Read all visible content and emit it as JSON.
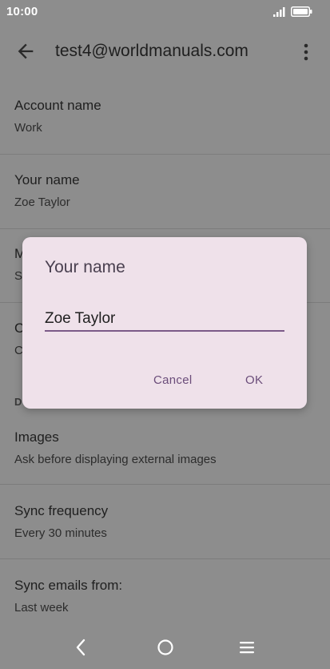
{
  "status_bar": {
    "time": "10:00",
    "icons": [
      "signal-icon",
      "battery-icon"
    ]
  },
  "app_bar": {
    "title": "test4@worldmanuals.com",
    "back_icon": "arrow-back-icon",
    "menu_icon": "more-vert-icon"
  },
  "settings": {
    "account_name": {
      "title": "Account name",
      "value": "Work"
    },
    "your_name": {
      "title": "Your name",
      "value": "Zoe Taylor"
    },
    "hidden_item_1": {
      "title": "M",
      "value": "S"
    },
    "hidden_item_2": {
      "title": "C",
      "value": "C"
    },
    "section_header": "D",
    "images": {
      "title": "Images",
      "value": "Ask before displaying external images"
    },
    "sync_frequency": {
      "title": "Sync frequency",
      "value": "Every 30 minutes"
    },
    "sync_emails_from": {
      "title": "Sync emails from:",
      "value": "Last week"
    }
  },
  "dialog": {
    "title": "Your name",
    "input_value": "Zoe Taylor",
    "cancel_label": "Cancel",
    "ok_label": "OK"
  },
  "nav_bar": {
    "icons": [
      "back-nav-icon",
      "home-nav-icon",
      "menu-nav-icon"
    ]
  },
  "colors": {
    "scrim_background": "#8d8d8d",
    "dialog_background": "#efe1ea",
    "accent": "#6b4d7a"
  }
}
